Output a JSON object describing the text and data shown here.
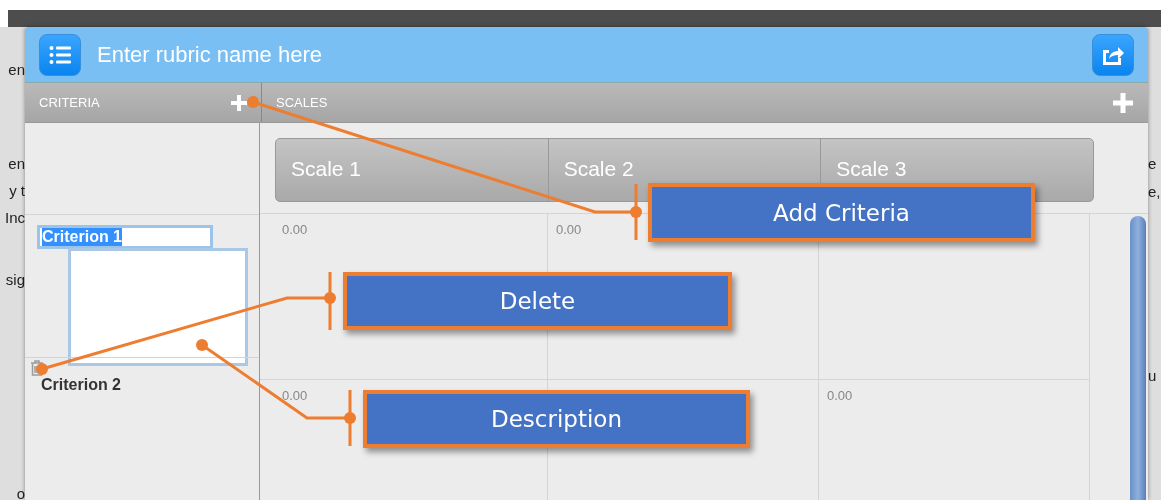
{
  "header": {
    "title": "Enter rubric name here"
  },
  "criteria_header": {
    "label": "CRITERIA"
  },
  "scales_header": {
    "label": "SCALES"
  },
  "scales": [
    "Scale 1",
    "Scale 2",
    "Scale 3"
  ],
  "criteria": [
    {
      "name": "Criterion 1",
      "editing": true,
      "cells": [
        "0.00",
        "0.00",
        null
      ]
    },
    {
      "name": "Criterion 2",
      "editing": false,
      "cells": [
        "0.00",
        null,
        "0.00"
      ]
    }
  ],
  "callouts": [
    {
      "text": "Add Criteria"
    },
    {
      "text": "Delete"
    },
    {
      "text": "Description"
    }
  ],
  "background_text": {
    "left": [
      "en",
      "en",
      "y t",
      "Inc",
      "sig",
      "o"
    ],
    "right": [
      "e",
      "e,",
      "u"
    ]
  }
}
